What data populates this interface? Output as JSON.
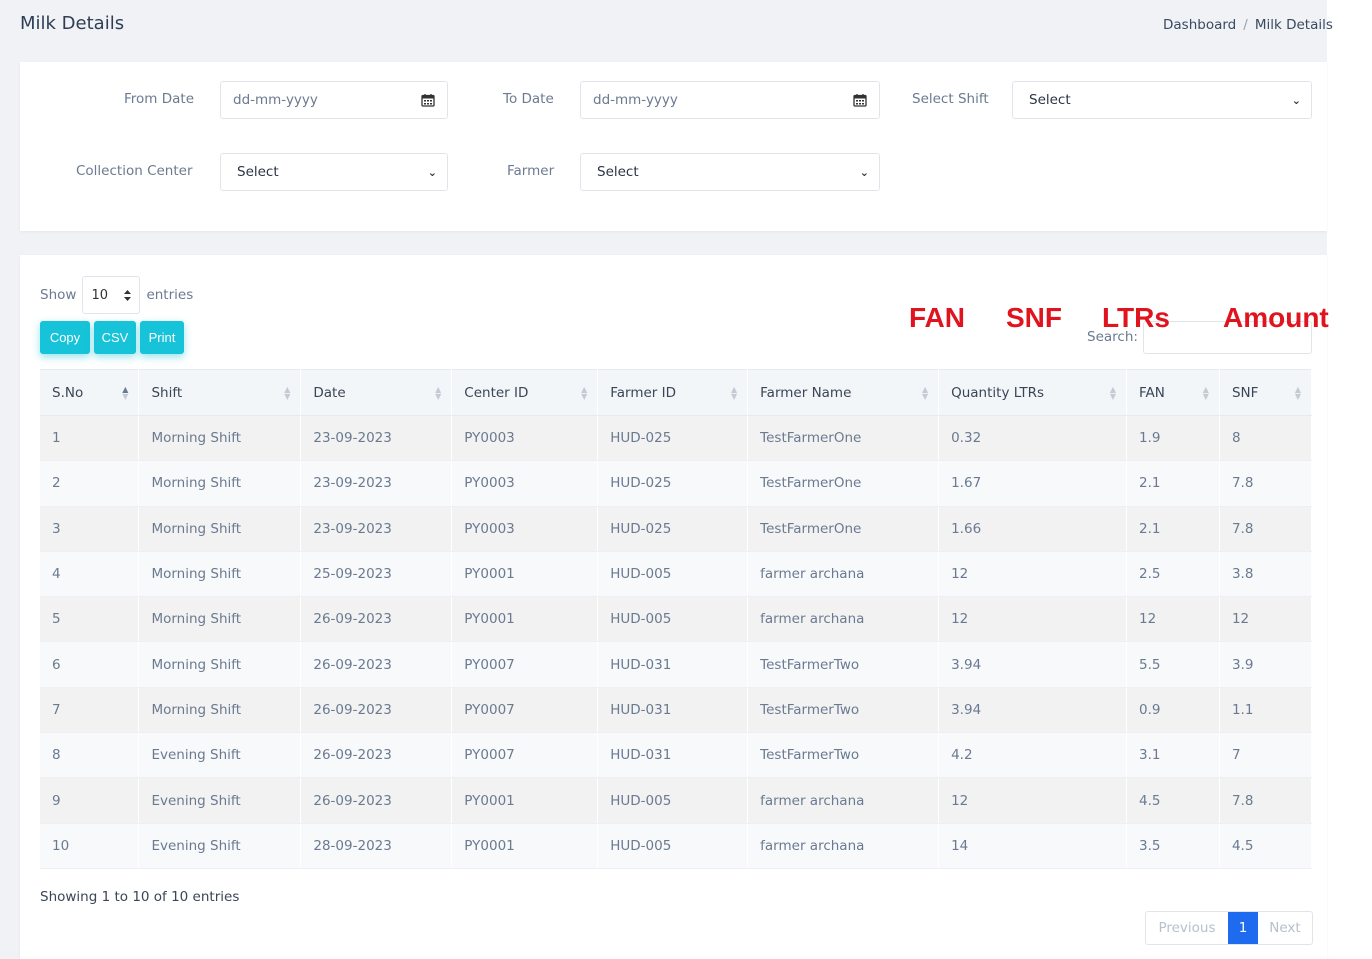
{
  "page": {
    "title": "Milk Details"
  },
  "breadcrumb": {
    "home": "Dashboard",
    "separator": "/",
    "current": "Milk Details"
  },
  "filters": {
    "from_date_label": "From Date",
    "from_date_placeholder": "dd-mm-yyyy",
    "to_date_label": "To Date",
    "to_date_placeholder": "dd-mm-yyyy",
    "shift_label": "Select Shift",
    "shift_value": "Select",
    "center_label": "Collection Center",
    "center_value": "Select",
    "farmer_label": "Farmer",
    "farmer_value": "Select"
  },
  "table_controls": {
    "show_label": "Show",
    "entries_value": "10",
    "entries_label": "entries",
    "buttons": {
      "copy": "Copy",
      "csv": "CSV",
      "print": "Print"
    },
    "search_label": "Search:"
  },
  "table": {
    "columns": [
      "S.No",
      "Shift",
      "Date",
      "Center ID",
      "Farmer ID",
      "Farmer Name",
      "Quantity LTRs",
      "FAN",
      "SNF"
    ],
    "rows": [
      [
        "1",
        "Morning Shift",
        "23-09-2023",
        "PY0003",
        "HUD-025",
        "TestFarmerOne",
        "0.32",
        "1.9",
        "8"
      ],
      [
        "2",
        "Morning Shift",
        "23-09-2023",
        "PY0003",
        "HUD-025",
        "TestFarmerOne",
        "1.67",
        "2.1",
        "7.8"
      ],
      [
        "3",
        "Morning Shift",
        "23-09-2023",
        "PY0003",
        "HUD-025",
        "TestFarmerOne",
        "1.66",
        "2.1",
        "7.8"
      ],
      [
        "4",
        "Morning Shift",
        "25-09-2023",
        "PY0001",
        "HUD-005",
        "farmer archana",
        "12",
        "2.5",
        "3.8"
      ],
      [
        "5",
        "Morning Shift",
        "26-09-2023",
        "PY0001",
        "HUD-005",
        "farmer archana",
        "12",
        "12",
        "12"
      ],
      [
        "6",
        "Morning Shift",
        "26-09-2023",
        "PY0007",
        "HUD-031",
        "TestFarmerTwo",
        "3.94",
        "5.5",
        "3.9"
      ],
      [
        "7",
        "Morning Shift",
        "26-09-2023",
        "PY0007",
        "HUD-031",
        "TestFarmerTwo",
        "3.94",
        "0.9",
        "1.1"
      ],
      [
        "8",
        "Evening Shift",
        "26-09-2023",
        "PY0007",
        "HUD-031",
        "TestFarmerTwo",
        "4.2",
        "3.1",
        "7"
      ],
      [
        "9",
        "Evening Shift",
        "26-09-2023",
        "PY0001",
        "HUD-005",
        "farmer archana",
        "12",
        "4.5",
        "7.8"
      ],
      [
        "10",
        "Evening Shift",
        "28-09-2023",
        "PY0001",
        "HUD-005",
        "farmer archana",
        "14",
        "3.5",
        "4.5"
      ]
    ]
  },
  "footer": {
    "info": "Showing 1 to 10 of 10 entries",
    "previous": "Previous",
    "current_page": "1",
    "next": "Next"
  },
  "overlay_labels": [
    "FAN",
    "SNF",
    "LTRs",
    "Amount"
  ],
  "colors": {
    "accent_button": "#16c3d9",
    "page_active": "#1e6bf0",
    "overlay_text": "#e0141e"
  }
}
